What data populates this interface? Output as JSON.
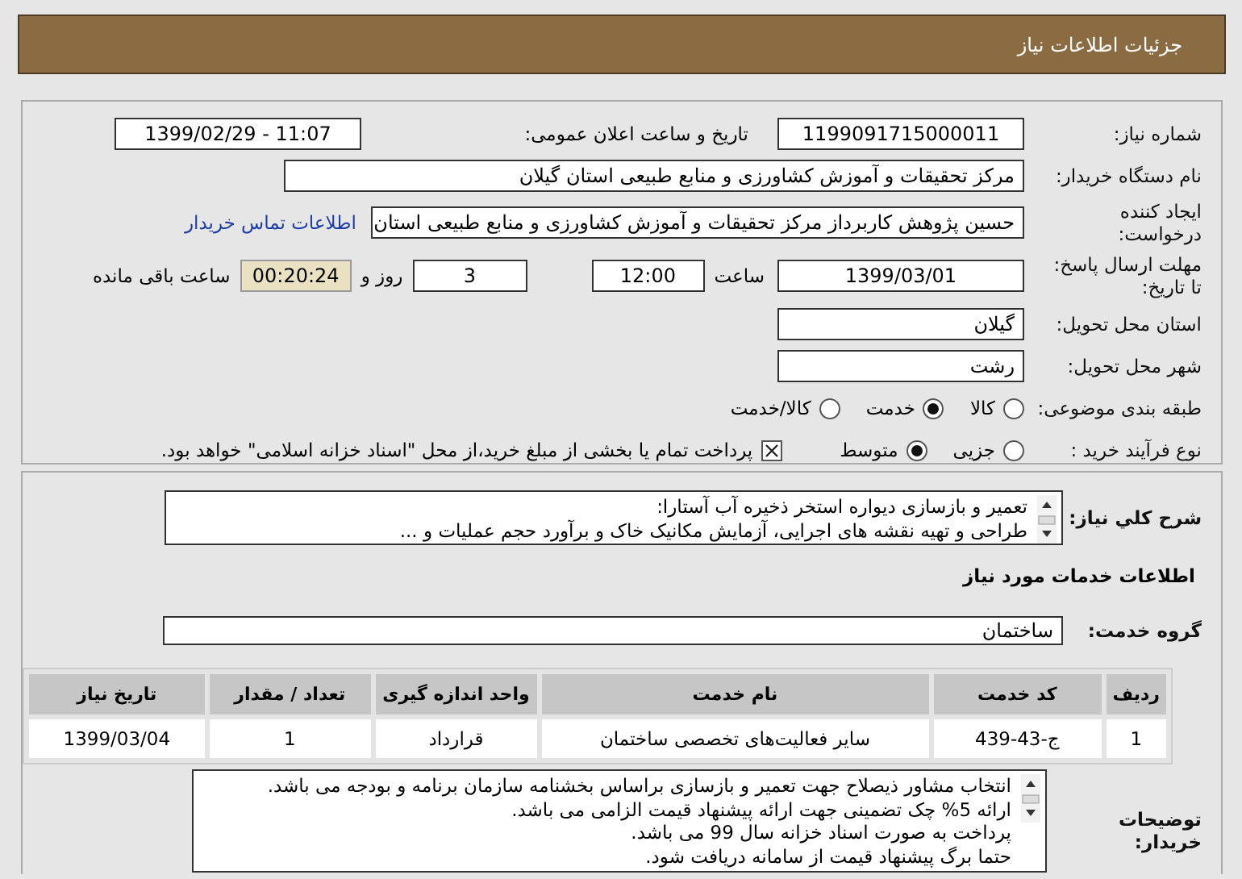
{
  "header": {
    "title": "جزئیات اطلاعات نیاز"
  },
  "details": {
    "need_number": {
      "label": "شماره نیاز:",
      "value": "1199091715000011"
    },
    "announce": {
      "label": "تاریخ و ساعت اعلان عمومی:",
      "value": "1399/02/29 - 11:07"
    },
    "buyer_org": {
      "label": "نام دستگاه خریدار:",
      "value": "مرکز تحقیقات و آموزش کشاورزی و منابع طبیعی استان گیلان"
    },
    "requester": {
      "label": "ایجاد کننده درخواست:",
      "value": "حسین پژوهش کاربرداز مرکز تحقیقات و آموزش کشاورزی و منابع طبیعی استان",
      "link": "اطلاعات تماس خریدار"
    },
    "deadline": {
      "label": "مهلت ارسال پاسخ: تا تاریخ:",
      "date": "1399/03/01",
      "time_label": "ساعت",
      "time": "12:00",
      "days": "3",
      "days_label": "روز و",
      "remaining": "00:20:24",
      "remaining_label": "ساعت باقی مانده"
    },
    "province": {
      "label": "استان محل تحویل:",
      "value": "گیلان"
    },
    "city": {
      "label": "شهر محل تحویل:",
      "value": "رشت"
    },
    "category": {
      "label": "طبقه بندی موضوعی:",
      "options": [
        {
          "label": "کالا",
          "selected": false
        },
        {
          "label": "خدمت",
          "selected": true
        },
        {
          "label": "کالا/خدمت",
          "selected": false
        }
      ]
    },
    "process": {
      "label": "نوع فرآیند خرید :",
      "options": [
        {
          "label": "جزیی",
          "selected": false
        },
        {
          "label": "متوسط",
          "selected": true
        }
      ],
      "payment": {
        "checked": true,
        "text": "پرداخت تمام یا بخشی از مبلغ خرید،از محل \"اسناد خزانه اسلامی\" خواهد بود."
      }
    }
  },
  "description": {
    "label": "شرح کلي نياز:",
    "lines": [
      "تعمیر و بازسازی دیواره استخر ذخیره آب آستارا:",
      "طراحی و تهیه نقشه های اجرایی، آزمایش مکانیک خاک و برآورد حجم عملیات و ..."
    ]
  },
  "services_heading": "اطلاعات خدمات مورد نیاز",
  "service_group": {
    "label": "گروه خدمت:",
    "value": "ساختمان"
  },
  "table": {
    "columns": [
      "ردیف",
      "کد خدمت",
      "نام خدمت",
      "واحد اندازه گیری",
      "تعداد / مقدار",
      "تاریخ نیاز"
    ],
    "rows": [
      [
        "1",
        "ج-43-439",
        "سایر فعالیت‌های تخصصی ساختمان",
        "قرارداد",
        "1",
        "1399/03/04"
      ]
    ]
  },
  "buyer_notes": {
    "label": "توضیحات خریدار:",
    "lines": [
      "انتخاب مشاور ذیصلاح جهت تعمیر و بازسازی براساس بخشنامه سازمان برنامه و بودجه می باشد.",
      "ارائه 5% چک تضمینی جهت ارائه پیشنهاد قیمت الزامی می باشد.",
      "پرداخت به صورت اسناد خزانه سال 99 می باشد.",
      "حتما برگ پیشنهاد قیمت از سامانه دریافت شود."
    ]
  }
}
